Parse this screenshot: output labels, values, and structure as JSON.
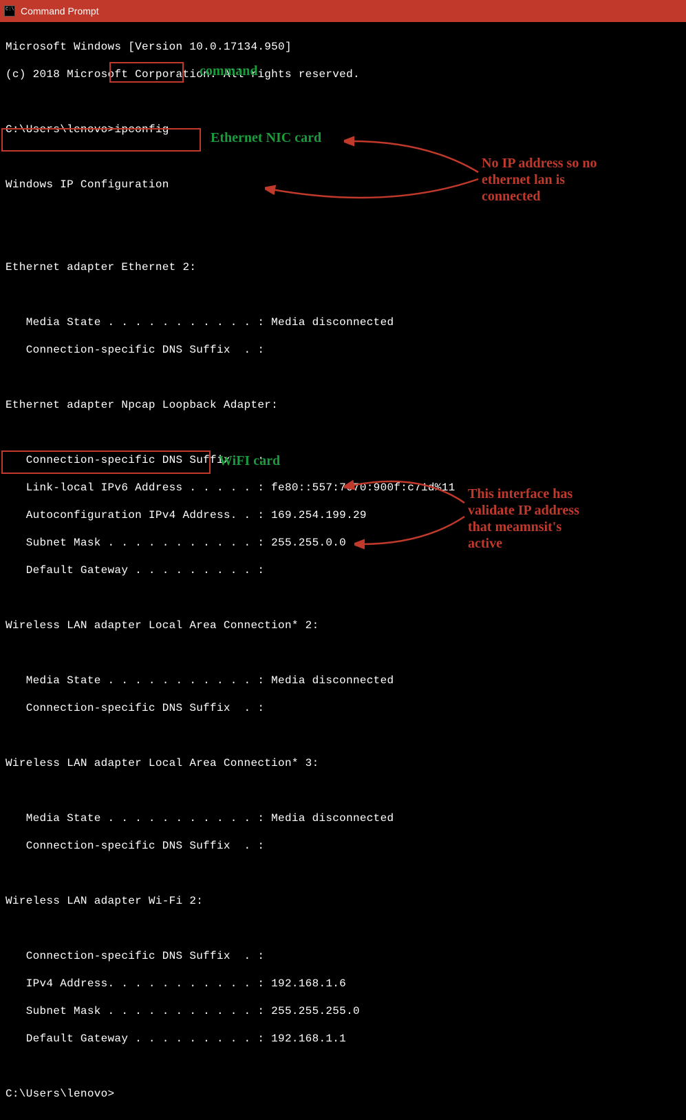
{
  "window": {
    "title": "Command Prompt"
  },
  "lines": {
    "ms_version": "Microsoft Windows [Version 10.0.17134.950]",
    "copyright": "(c) 2018 Microsoft Corporation. All rights reserved.",
    "prompt1": "C:\\Users\\lenovo>",
    "cmd": "ipconfig",
    "header": "Windows IP Configuration",
    "eth2_title": "Ethernet adapter Ethernet 2:",
    "media_state_disconnected": "   Media State . . . . . . . . . . . : Media disconnected",
    "dns_suffix_blank": "   Connection-specific DNS Suffix  . :",
    "npcap_title": "Ethernet adapter Npcap Loopback Adapter:",
    "npcap_dns": "   Connection-specific DNS Suffix  . :",
    "npcap_ipv6": "   Link-local IPv6 Address . . . . . : fe80::557:7670:900f:c71d%11",
    "npcap_auto": "   Autoconfiguration IPv4 Address. . : 169.254.199.29",
    "npcap_mask": "   Subnet Mask . . . . . . . . . . . : 255.255.0.0",
    "npcap_gw": "   Default Gateway . . . . . . . . . :",
    "lac2_title": "Wireless LAN adapter Local Area Connection* 2:",
    "lac3_title": "Wireless LAN adapter Local Area Connection* 3:",
    "wifi_title": "Wireless LAN adapter Wi-Fi 2:",
    "wifi_dns": "   Connection-specific DNS Suffix  . :",
    "wifi_ipv4": "   IPv4 Address. . . . . . . . . . . : 192.168.1.6",
    "wifi_mask": "   Subnet Mask . . . . . . . . . . . : 255.255.255.0",
    "wifi_gw": "   Default Gateway . . . . . . . . . : 192.168.1.1",
    "prompt2": "C:\\Users\\lenovo>"
  },
  "annotations": {
    "command_label": "command",
    "ethernet_nic_label": "Ethernet NIC card",
    "wifi_card_label": "WiFI card",
    "no_ip_l1": "No IP address so no",
    "no_ip_l2": "ethernet lan is",
    "no_ip_l3": "connected",
    "valid_l1": "This interface has",
    "valid_l2": "validate IP address",
    "valid_l3": "that meamnsit's",
    "valid_l4": "active"
  }
}
